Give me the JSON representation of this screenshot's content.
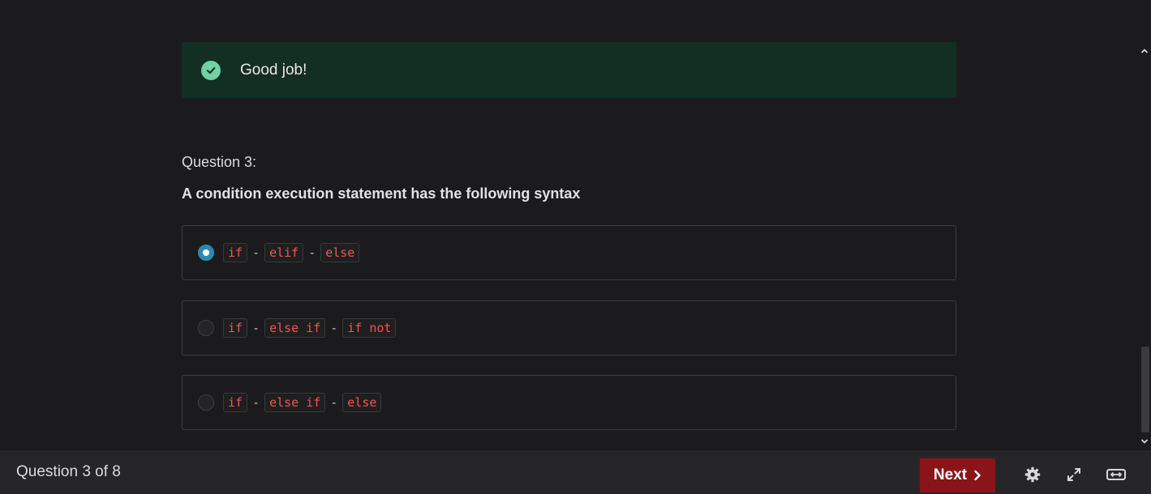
{
  "feedback": {
    "message": "Good job!",
    "icon": "check-circle-icon",
    "color": "#6fd3a3"
  },
  "question": {
    "number_label": "Question 3:",
    "text": "A condition execution statement has the following syntax"
  },
  "options": [
    {
      "selected": true,
      "parts": [
        "if",
        "elif",
        "else"
      ],
      "separator": "-"
    },
    {
      "selected": false,
      "parts": [
        "if",
        "else if",
        "if not"
      ],
      "separator": "-"
    },
    {
      "selected": false,
      "parts": [
        "if",
        "else if",
        "else"
      ],
      "separator": "-"
    }
  ],
  "footer": {
    "progress": "Question 3 of 8",
    "next_label": "Next",
    "accent": "#8a1519",
    "icons": [
      "gear-icon",
      "fullscreen-icon",
      "width-toggle-icon"
    ]
  }
}
